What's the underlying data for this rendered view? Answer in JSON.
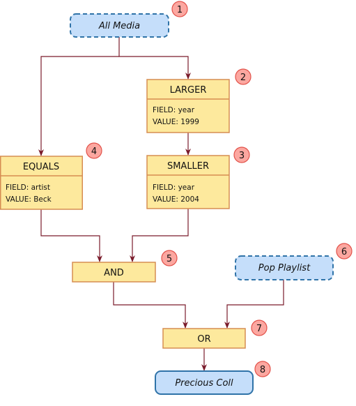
{
  "nodes": {
    "all_media": {
      "label": "All Media",
      "badge": "1"
    },
    "larger": {
      "label": "LARGER",
      "field": "FIELD: year",
      "value": "VALUE: 1999",
      "badge": "2"
    },
    "smaller": {
      "label": "SMALLER",
      "field": "FIELD: year",
      "value": "VALUE: 2004",
      "badge": "3"
    },
    "equals": {
      "label": "EQUALS",
      "field": "FIELD: artist",
      "value": "VALUE: Beck",
      "badge": "4"
    },
    "and": {
      "label": "AND",
      "badge": "5"
    },
    "pop_playlist": {
      "label": "Pop Playlist",
      "badge": "6"
    },
    "or": {
      "label": "OR",
      "badge": "7"
    },
    "precious": {
      "label": "Precious Coll",
      "badge": "8"
    }
  },
  "edges": [
    [
      "all_media",
      "larger"
    ],
    [
      "all_media",
      "equals"
    ],
    [
      "larger",
      "smaller"
    ],
    [
      "equals",
      "and"
    ],
    [
      "smaller",
      "and"
    ],
    [
      "and",
      "or"
    ],
    [
      "pop_playlist",
      "or"
    ],
    [
      "or",
      "precious"
    ]
  ],
  "colors": {
    "source_fill": "#c5defa",
    "source_border": "#2f73a8",
    "operator_fill": "#fde99d",
    "operator_border": "#d68d52",
    "edge": "#7a1b2b",
    "badge_fill": "#fca7a0"
  }
}
